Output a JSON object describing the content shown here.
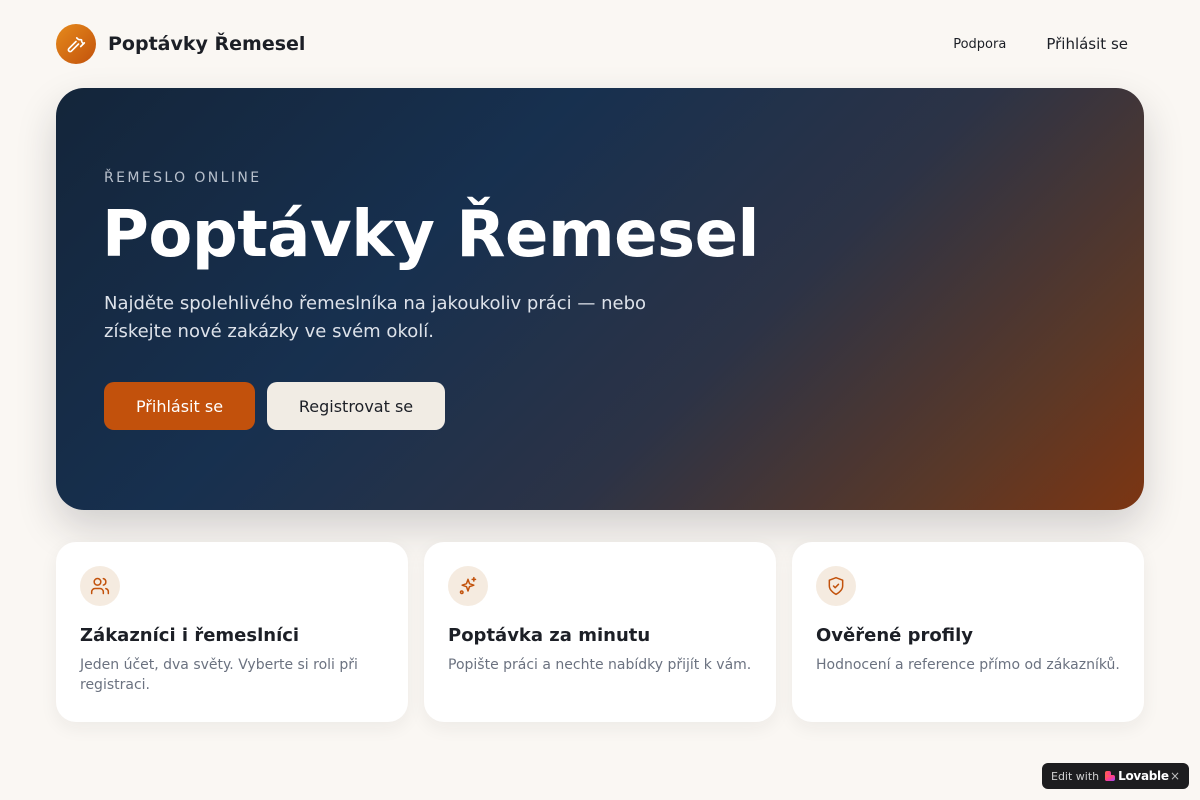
{
  "header": {
    "brand_name": "Poptávky Řemesel",
    "logo_icon": "hammer-icon",
    "nav": {
      "support": "Podpora",
      "login": "Přihlásit se"
    }
  },
  "hero": {
    "eyebrow": "ŘEMESLO ONLINE",
    "title": "Poptávky Řemesel",
    "description": "Najděte spolehlivého řemeslníka na jakoukoliv práci — nebo získejte nové zakázky ve svém okolí.",
    "primary_button": "Přihlásit se",
    "secondary_button": "Registrovat se"
  },
  "features": [
    {
      "icon": "users-icon",
      "title": "Zákazníci i řemeslníci",
      "text": "Jeden účet, dva světy. Vyberte si roli při registraci."
    },
    {
      "icon": "sparkles-icon",
      "title": "Poptávka za minutu",
      "text": "Popište práci a nechte nabídky přijít k vám."
    },
    {
      "icon": "shield-check-icon",
      "title": "Ověřené profily",
      "text": "Hodnocení a reference přímo od zákazníků."
    }
  ],
  "badge": {
    "prefix": "Edit with",
    "brand": "Lovable",
    "close": "×"
  },
  "colors": {
    "accent": "#c2510c",
    "background": "#faf7f3",
    "icon_accent": "#c2520c"
  }
}
